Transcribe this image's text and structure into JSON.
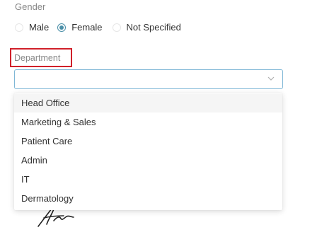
{
  "gender": {
    "label": "Gender",
    "options": [
      {
        "label": "Male",
        "checked": false
      },
      {
        "label": "Female",
        "checked": true
      },
      {
        "label": "Not Specified",
        "checked": false
      }
    ]
  },
  "department": {
    "label": "Department",
    "highlight_color": "#d0202a",
    "selected_value": "",
    "options": [
      "Head Office",
      "Marketing & Sales",
      "Patient Care",
      "Admin",
      "IT",
      "Dermatology"
    ],
    "active_option": "Head Office"
  },
  "colors": {
    "accent": "#4a8fa8",
    "focus_border": "#7fb7d6",
    "label": "#888888",
    "text": "#333333"
  },
  "icons": {
    "select_arrow": "chevron-down-icon"
  }
}
